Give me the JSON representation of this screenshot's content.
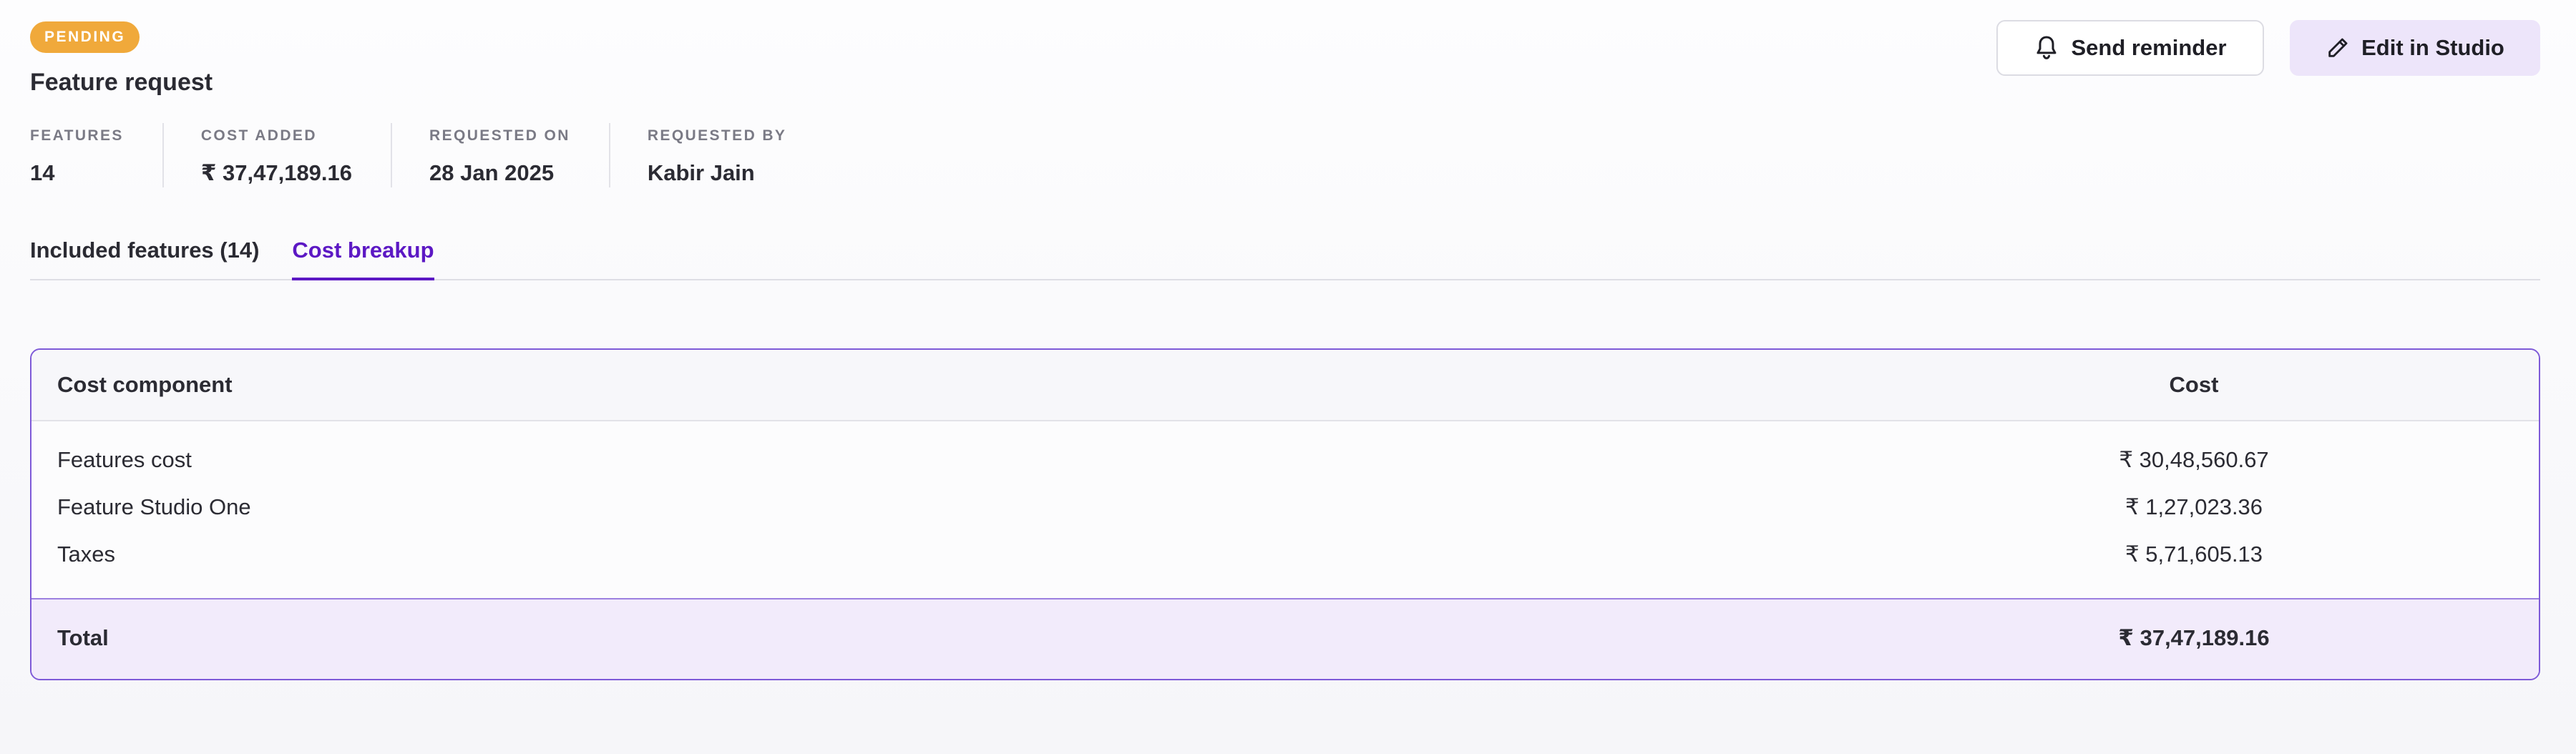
{
  "header": {
    "status_badge": "PENDING",
    "title": "Feature request",
    "actions": {
      "send_reminder": "Send reminder",
      "edit_in_studio": "Edit in Studio"
    }
  },
  "meta": [
    {
      "label": "FEATURES",
      "value": "14"
    },
    {
      "label": "COST ADDED",
      "value": "₹ 37,47,189.16"
    },
    {
      "label": "REQUESTED ON",
      "value": "28 Jan 2025"
    },
    {
      "label": "REQUESTED BY",
      "value": "Kabir Jain"
    }
  ],
  "tabs": [
    {
      "label": "Included features (14)",
      "active": false
    },
    {
      "label": "Cost breakup",
      "active": true
    }
  ],
  "cost_table": {
    "columns": [
      "Cost component",
      "Cost"
    ],
    "rows": [
      {
        "component": "Features cost",
        "cost": "₹ 30,48,560.67"
      },
      {
        "component": "Feature Studio One",
        "cost": "₹ 1,27,023.36"
      },
      {
        "component": "Taxes",
        "cost": "₹ 5,71,605.13"
      }
    ],
    "total": {
      "label": "Total",
      "cost": "₹ 37,47,189.16"
    }
  },
  "colors": {
    "accent": "#5c18c4",
    "badge": "#f0a93b",
    "table_border": "#7e5ad8",
    "total_row_bg": "#f2ebfb"
  },
  "icons": {
    "send_reminder": "bell-icon",
    "edit_in_studio": "pencil-icon"
  }
}
